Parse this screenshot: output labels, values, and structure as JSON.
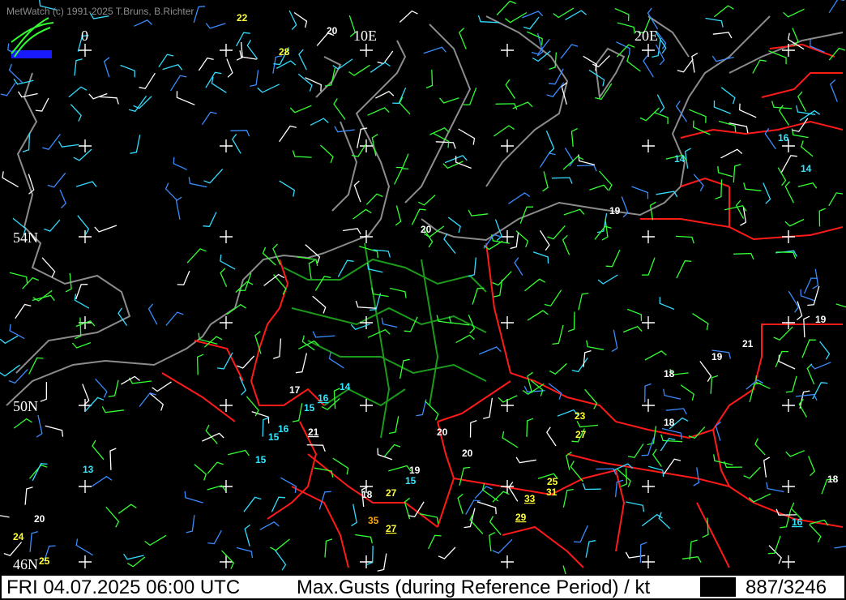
{
  "app": {
    "name": "MetWatch",
    "copyright": "MetWatch  (c) 1991-2025 T.Bruns, B.Richter"
  },
  "status": {
    "datetime": "FRI 04.07.2025 06:00 UTC",
    "parameter": "Max.Gusts (during Reference Period) / kt",
    "count": "887/3246"
  },
  "grid_labels": {
    "lon": [
      "0",
      "10E",
      "20E"
    ],
    "lat": [
      "54N",
      "50N",
      "46N"
    ]
  },
  "colors": {
    "background": "#000000",
    "coastline": "#8c8c8c",
    "border_country": "#ff1a1a",
    "border_state": "#1c9a1c",
    "barb_white": "#ffffff",
    "barb_green": "#33ff33",
    "barb_cyan": "#33ddff",
    "barb_blue": "#3a8cff",
    "value_white": "#ffffff",
    "value_cyan": "#33e6ff",
    "value_yellow": "#ffff33",
    "value_orange": "#ffa500"
  },
  "gust_values": [
    {
      "v": "22",
      "c": "yellow"
    },
    {
      "v": "20",
      "c": "white"
    },
    {
      "v": "28",
      "c": "yellow"
    },
    {
      "v": "16",
      "c": "cyan"
    },
    {
      "v": "14",
      "c": "cyan"
    },
    {
      "v": "14",
      "c": "cyan"
    },
    {
      "v": "19",
      "c": "white"
    },
    {
      "v": "20",
      "c": "white"
    },
    {
      "v": "19",
      "c": "white"
    },
    {
      "v": "21",
      "c": "white"
    },
    {
      "v": "19",
      "c": "white"
    },
    {
      "v": "18",
      "c": "white"
    },
    {
      "v": "17",
      "c": "white"
    },
    {
      "v": "14",
      "c": "cyan"
    },
    {
      "v": "15",
      "c": "cyan"
    },
    {
      "v": "16",
      "c": "cyan",
      "u": true
    },
    {
      "v": "23",
      "c": "yellow"
    },
    {
      "v": "18",
      "c": "white"
    },
    {
      "v": "16",
      "c": "cyan"
    },
    {
      "v": "15",
      "c": "cyan"
    },
    {
      "v": "21",
      "c": "white",
      "u": true
    },
    {
      "v": "20",
      "c": "white"
    },
    {
      "v": "27",
      "c": "yellow"
    },
    {
      "v": "20",
      "c": "white"
    },
    {
      "v": "15",
      "c": "cyan"
    },
    {
      "v": "13",
      "c": "cyan"
    },
    {
      "v": "19",
      "c": "white"
    },
    {
      "v": "15",
      "c": "cyan"
    },
    {
      "v": "18",
      "c": "white"
    },
    {
      "v": "27",
      "c": "yellow"
    },
    {
      "v": "25",
      "c": "yellow"
    },
    {
      "v": "31",
      "c": "yellow"
    },
    {
      "v": "33",
      "c": "yellow",
      "u": true
    },
    {
      "v": "18",
      "c": "white"
    },
    {
      "v": "29",
      "c": "yellow",
      "u": true
    },
    {
      "v": "35",
      "c": "orange"
    },
    {
      "v": "27",
      "c": "yellow",
      "u": true
    },
    {
      "v": "16",
      "c": "cyan",
      "u": true
    },
    {
      "v": "20",
      "c": "white"
    },
    {
      "v": "24",
      "c": "yellow"
    },
    {
      "v": "25",
      "c": "yellow"
    }
  ]
}
